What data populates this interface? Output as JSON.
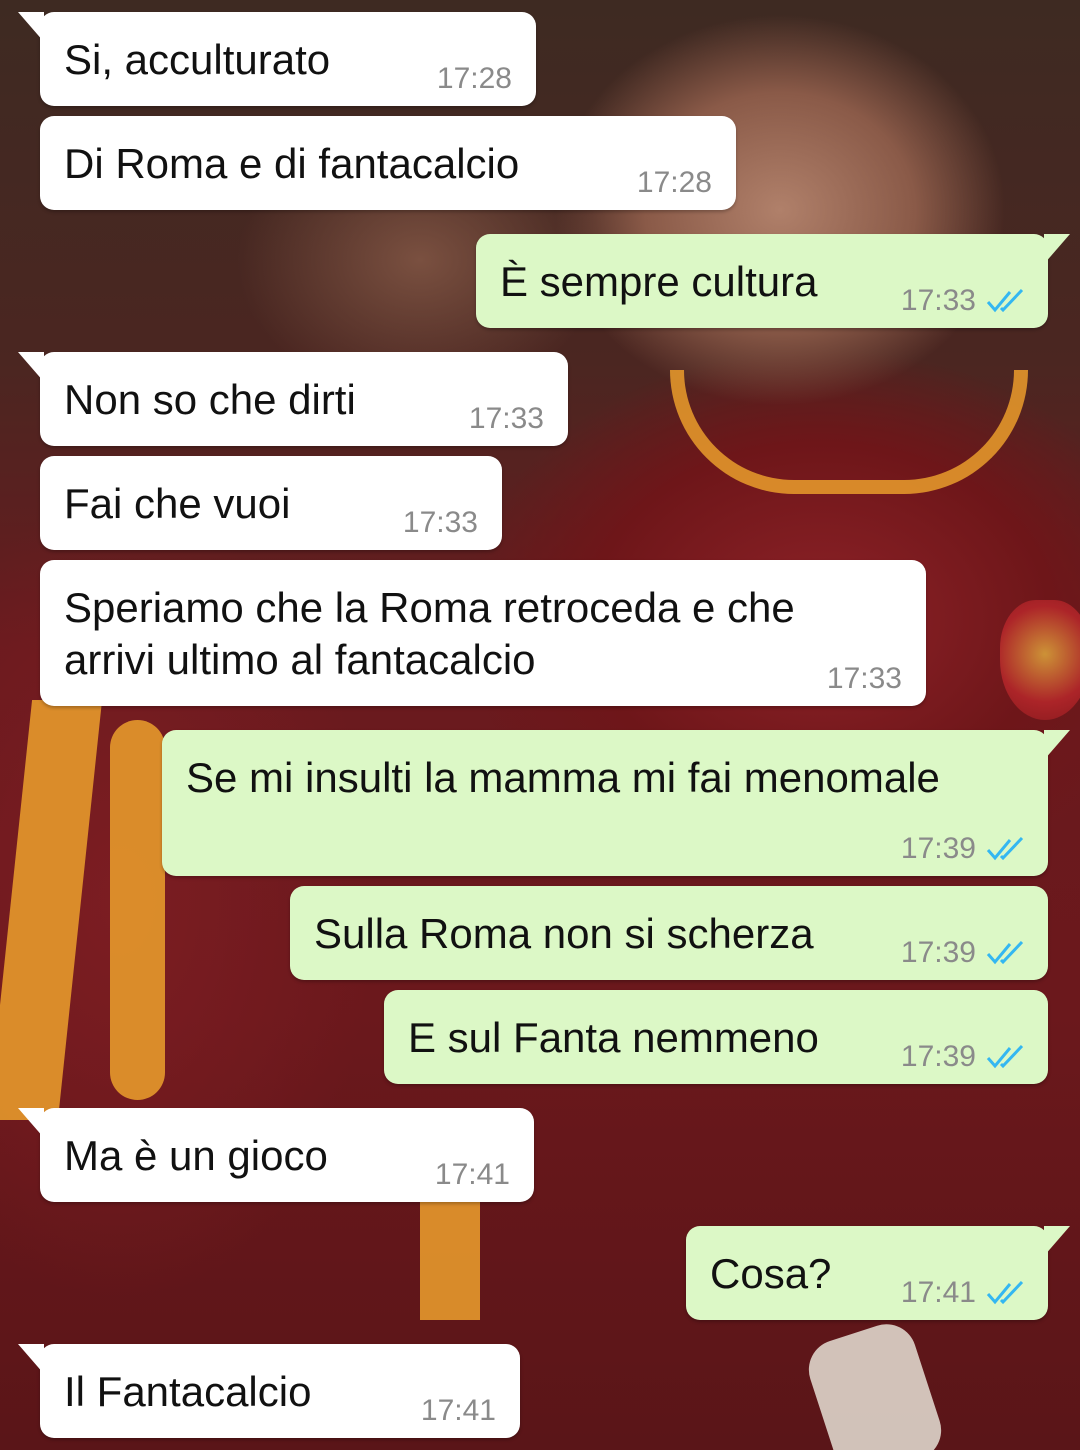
{
  "theme": {
    "incoming_bubble": "#ffffff",
    "outgoing_bubble": "#dcf8c6",
    "read_ticks_color": "#34b7f1",
    "timestamp_color": "#8a8a8a"
  },
  "messages": [
    {
      "direction": "in",
      "text": "Si, acculturato",
      "time": "17:28"
    },
    {
      "direction": "in",
      "text": "Di Roma e di fantacalcio",
      "time": "17:28"
    },
    {
      "direction": "out",
      "text": "È sempre cultura",
      "time": "17:33",
      "status": "read"
    },
    {
      "direction": "in",
      "text": "Non so che dirti",
      "time": "17:33"
    },
    {
      "direction": "in",
      "text": "Fai che vuoi",
      "time": "17:33"
    },
    {
      "direction": "in",
      "text": "Speriamo che la Roma retroceda e che arrivi ultimo al fantacalcio",
      "time": "17:33"
    },
    {
      "direction": "out",
      "text": "Se mi insulti la mamma mi fai menomale",
      "time": "17:39",
      "status": "read"
    },
    {
      "direction": "out",
      "text": "Sulla Roma non si scherza",
      "time": "17:39",
      "status": "read"
    },
    {
      "direction": "out",
      "text": "E sul Fanta nemmeno",
      "time": "17:39",
      "status": "read"
    },
    {
      "direction": "in",
      "text": "Ma è un gioco",
      "time": "17:41"
    },
    {
      "direction": "out",
      "text": "Cosa?",
      "time": "17:41",
      "status": "read"
    },
    {
      "direction": "in",
      "text": "Il Fantacalcio",
      "time": "17:41"
    }
  ]
}
